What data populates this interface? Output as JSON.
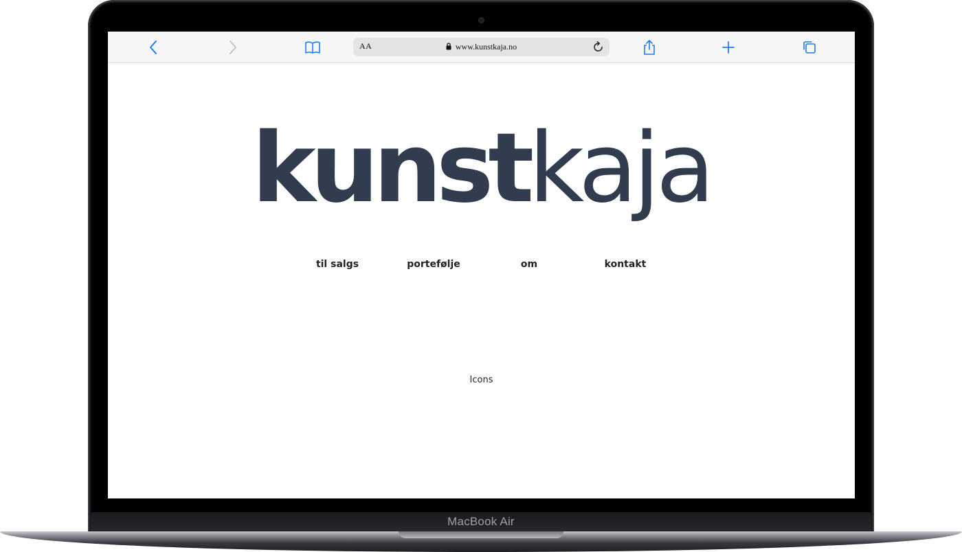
{
  "device": {
    "model_label": "MacBook Air"
  },
  "browser": {
    "reader_label": "AA",
    "url": "www.kunstkaja.no",
    "accent_color": "#1a7cf5",
    "icons": [
      "back-icon",
      "forward-icon",
      "bookmarks-icon",
      "lock-icon",
      "reload-icon",
      "share-icon",
      "new-tab-icon",
      "tabs-icon"
    ]
  },
  "page": {
    "logo": {
      "bold": "kunst",
      "light": "kaja",
      "color": "#313c4e"
    },
    "nav": [
      {
        "label": "til salgs"
      },
      {
        "label": "portefølje"
      },
      {
        "label": "om"
      },
      {
        "label": "kontakt"
      }
    ],
    "icons_placeholder": "Icons"
  }
}
